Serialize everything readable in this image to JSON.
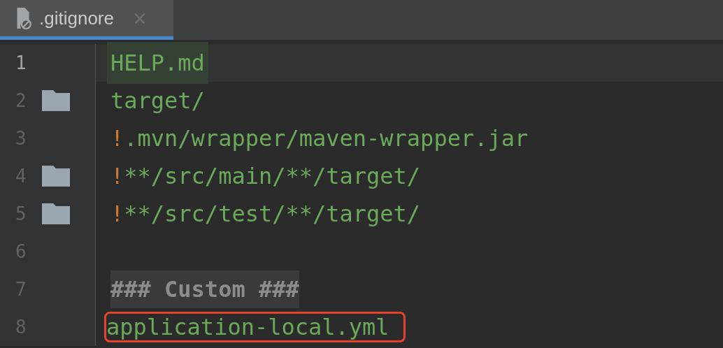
{
  "tab": {
    "label": ".gitignore",
    "close": "×",
    "selected": true
  },
  "lines": [
    {
      "number": "1",
      "current": true,
      "folder": false,
      "annotated": false,
      "tokens": [
        {
          "kind": "pattern",
          "text": "HELP.md"
        }
      ]
    },
    {
      "number": "2",
      "current": false,
      "folder": true,
      "annotated": false,
      "tokens": [
        {
          "kind": "pattern",
          "text": "target/"
        }
      ]
    },
    {
      "number": "3",
      "current": false,
      "folder": false,
      "annotated": false,
      "tokens": [
        {
          "kind": "negation",
          "text": "!"
        },
        {
          "kind": "pattern",
          "text": ".mvn/wrapper/maven-wrapper.jar"
        }
      ]
    },
    {
      "number": "4",
      "current": false,
      "folder": true,
      "annotated": false,
      "tokens": [
        {
          "kind": "negation",
          "text": "!"
        },
        {
          "kind": "pattern",
          "text": "**/src/main/**/target/"
        }
      ]
    },
    {
      "number": "5",
      "current": false,
      "folder": true,
      "annotated": false,
      "tokens": [
        {
          "kind": "negation",
          "text": "!"
        },
        {
          "kind": "pattern",
          "text": "**/src/test/**/target/"
        }
      ]
    },
    {
      "number": "6",
      "current": false,
      "folder": false,
      "annotated": false
    },
    {
      "number": "7",
      "current": false,
      "folder": false,
      "annotated": false,
      "tokens": [
        {
          "kind": "comment",
          "text": "### Custom ###"
        }
      ]
    },
    {
      "number": "8",
      "current": false,
      "folder": false,
      "annotated": true,
      "tokens": [
        {
          "kind": "pattern",
          "text": "application-local.yml"
        }
      ]
    }
  ]
}
